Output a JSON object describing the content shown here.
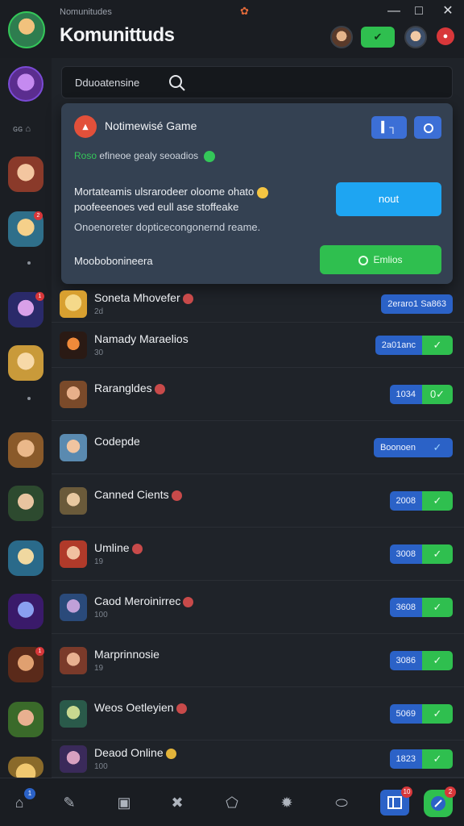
{
  "header": {
    "subtitle": "Nomunitudes",
    "title": "Komunittuds",
    "green_button": "✔",
    "red_button": "●",
    "window_controls": {
      "minimize": "—",
      "maximize": "□",
      "close": "✕"
    }
  },
  "rail": {
    "label": "ɢɢ ⌂",
    "badge": "2",
    "badge2": "1"
  },
  "search": {
    "text": "Dduoatensine"
  },
  "panel": {
    "title": "Notimewisé Game",
    "button_a": "▍┐",
    "status_prefix": "Roso",
    "status_text": "efineoe gealy seoadios",
    "message_line1": "Mortateamis ulsrarodeer oloome ohato",
    "message_line2": "poofeeenoes ved eull ase stoffeake",
    "message_line3": "Onoenoreter dopticecongonernd reame.",
    "cta_label": "nout",
    "footer_label": "Moobobonineera",
    "join_label": "Emlios"
  },
  "friends": [
    {
      "name": "Soneta Mhovefer",
      "sub": "2d",
      "value": "2eraro1  Sa863",
      "ok": ""
    },
    {
      "name": "Namady Maraelios",
      "sub": "30",
      "value": "2a01anc",
      "ok": "✓"
    },
    {
      "name": "Rarangldes",
      "sub": "",
      "value": "1034",
      "ok": "0✓"
    },
    {
      "name": "Codepde",
      "sub": "",
      "value": "Boonoen",
      "ok": "✓"
    },
    {
      "name": "Canned Cients",
      "sub": "",
      "value": "2008",
      "ok": "✓"
    },
    {
      "name": "Umline",
      "sub": "19",
      "value": "3008",
      "ok": "✓"
    },
    {
      "name": "Caod Meroinirrec",
      "sub": "100",
      "value": "3608",
      "ok": "✓"
    },
    {
      "name": "Marprinnosie",
      "sub": "19",
      "value": "3086",
      "ok": "✓"
    },
    {
      "name": "Weos Oetleyien",
      "sub": "",
      "value": "5069",
      "ok": "✓"
    },
    {
      "name": "Deaod Online",
      "sub": "100",
      "value": "1823",
      "ok": "✓"
    }
  ],
  "bottom_nav": {
    "badge_home": "1",
    "badge_square": "10",
    "badge_round": "2"
  },
  "colors": {
    "accent_green": "#2fbf4f",
    "accent_blue": "#2b62c7",
    "cta_blue": "#1ea5f2",
    "alert_red": "#d8373a"
  }
}
